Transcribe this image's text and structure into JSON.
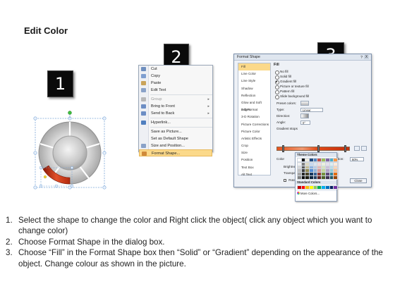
{
  "title": "Edit Color",
  "badges": [
    "1",
    "2",
    "3"
  ],
  "context_menu": {
    "items": [
      {
        "label": "Cut",
        "icon": "scissors-icon",
        "disabled": false,
        "submenu": false,
        "highlight": false,
        "color": "#6f8fbf"
      },
      {
        "label": "Copy",
        "icon": "copy-icon",
        "disabled": false,
        "submenu": false,
        "highlight": false,
        "color": "#7f9fd0"
      },
      {
        "label": "Paste",
        "icon": "paste-icon",
        "disabled": false,
        "submenu": false,
        "highlight": false,
        "color": "#c9a35a"
      },
      {
        "label": "Edit Text",
        "icon": "edit-text-icon",
        "disabled": false,
        "submenu": false,
        "highlight": false,
        "color": "#8aa2c8"
      },
      {
        "label": "Group",
        "icon": "group-icon",
        "disabled": true,
        "submenu": true,
        "highlight": false,
        "color": "#b8b8b8"
      },
      {
        "label": "Bring to Front",
        "icon": "bring-to-front-icon",
        "disabled": false,
        "submenu": true,
        "highlight": false,
        "color": "#6d8ec4"
      },
      {
        "label": "Send to Back",
        "icon": "send-to-back-icon",
        "disabled": false,
        "submenu": true,
        "highlight": false,
        "color": "#6d8ec4"
      },
      {
        "label": "Hyperlink...",
        "icon": "hyperlink-icon",
        "disabled": false,
        "submenu": false,
        "highlight": false,
        "color": "#4f7fbf"
      },
      {
        "label": "Save as Picture...",
        "icon": "",
        "disabled": false,
        "submenu": false,
        "highlight": false,
        "color": ""
      },
      {
        "label": "Set as Default Shape",
        "icon": "",
        "disabled": false,
        "submenu": false,
        "highlight": false,
        "color": ""
      },
      {
        "label": "Size and Position...",
        "icon": "size-position-icon",
        "disabled": false,
        "submenu": false,
        "highlight": false,
        "color": "#8aa2c8"
      },
      {
        "label": "Format Shape...",
        "icon": "format-shape-icon",
        "disabled": false,
        "submenu": false,
        "highlight": true,
        "color": "#d08a3a"
      }
    ]
  },
  "dialog": {
    "title": "Format Shape",
    "help": "?",
    "close": "X",
    "categories": [
      "Fill",
      "Line Color",
      "Line Style",
      "Shadow",
      "Reflection",
      "Glow and Soft Edges",
      "3-D Format",
      "3-D Rotation",
      "Picture Corrections",
      "Picture Color",
      "Artistic Effects",
      "Crop",
      "Size",
      "Position",
      "Text Box",
      "Alt Text"
    ],
    "selected_category": "Fill",
    "pane_heading": "Fill",
    "fill_options": [
      {
        "label": "No fill",
        "on": false
      },
      {
        "label": "Solid fill",
        "on": false
      },
      {
        "label": "Gradient fill",
        "on": true
      },
      {
        "label": "Picture or texture fill",
        "on": false
      },
      {
        "label": "Pattern fill",
        "on": false
      },
      {
        "label": "Slide background fill",
        "on": false
      }
    ],
    "fields": [
      {
        "label": "Preset colors:",
        "value": ""
      },
      {
        "label": "Type:",
        "value": "Linear"
      },
      {
        "label": "Direction:",
        "value": ""
      },
      {
        "label": "Angle:",
        "value": "0°"
      },
      {
        "label": "Gradient stops",
        "value": ""
      }
    ],
    "color_label": "Color",
    "position_label": "Position:",
    "position_value": "60%",
    "brightness_label": "Brightness",
    "transparency_label": "Transparency",
    "rotate_label": "Rotate",
    "close_button": "Close",
    "palette": {
      "theme_heading": "Theme Colors",
      "standard_heading": "Standard Colors",
      "more_colors": "More Colors...",
      "theme_top": [
        "#ffffff",
        "#000000",
        "#eeece1",
        "#1f497d",
        "#4f81bd",
        "#c0504d",
        "#9bbb59",
        "#8064a2",
        "#4bacc6",
        "#f79646"
      ],
      "theme_rows": [
        [
          "#f2f2f2",
          "#7f7f7f",
          "#ddd9c3",
          "#c6d9f0",
          "#dbe5f1",
          "#f2dcdb",
          "#ebf1dd",
          "#e5e0ec",
          "#dbeef3",
          "#fdeada"
        ],
        [
          "#d8d8d8",
          "#595959",
          "#c4bd97",
          "#8db3e2",
          "#b8cce4",
          "#e5b9b7",
          "#d7e3bc",
          "#ccc1d9",
          "#b7dde8",
          "#fbd5b5"
        ],
        [
          "#bfbfbf",
          "#3f3f3f",
          "#938953",
          "#548dd4",
          "#95b3d7",
          "#d99694",
          "#c3d69b",
          "#b2a2c7",
          "#92cddc",
          "#fac08f"
        ],
        [
          "#a5a5a5",
          "#262626",
          "#494429",
          "#17365d",
          "#366092",
          "#953734",
          "#76923c",
          "#5f497a",
          "#31859b",
          "#e36c09"
        ],
        [
          "#7f7f7f",
          "#0c0c0c",
          "#1d1b10",
          "#0f243e",
          "#244061",
          "#632423",
          "#4f6128",
          "#3f3151",
          "#205867",
          "#974806"
        ]
      ],
      "standard": [
        "#c00000",
        "#ff0000",
        "#ffc000",
        "#ffff00",
        "#92d050",
        "#00b050",
        "#00b0f0",
        "#0070c0",
        "#002060",
        "#7030a0"
      ]
    }
  },
  "instructions": [
    {
      "num": "1.",
      "text": "Select the shape to change the color and Right click the object( click any object which you want to change color)"
    },
    {
      "num": "2.",
      "text": "Choose Format Shape in the dialog box."
    },
    {
      "num": "3.",
      "text": "Choose “Fill” in the Format Shape box then “Solid” or “Gradient” depending on the appearance of the object. Change colour as shown in the picture."
    }
  ],
  "colors": {
    "accent": "#d8482a",
    "badge": "#0a0a0a",
    "highlight": "#fbd98a"
  }
}
